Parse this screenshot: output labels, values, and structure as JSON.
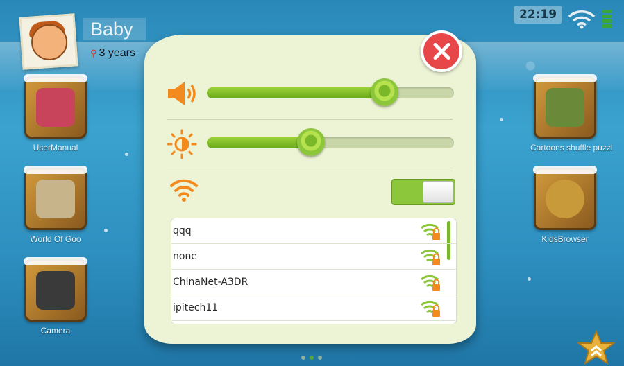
{
  "status_bar": {
    "time": "22:19"
  },
  "profile": {
    "name": "Baby",
    "age": "3 years"
  },
  "apps": {
    "user_manual": "UserManual",
    "world_of_goo": "World Of Goo",
    "camera": "Camera",
    "cartoons": "Cartoons shuffle puzzl",
    "kids_browser": "KidsBrowser"
  },
  "settings": {
    "volume_level": 0.72,
    "brightness_level": 0.42,
    "wifi_enabled": true,
    "networks": [
      {
        "name": "qqq",
        "secured": true
      },
      {
        "name": "none",
        "secured": true
      },
      {
        "name": "ChinaNet-A3DR",
        "secured": true
      },
      {
        "name": "ipitech11",
        "secured": true
      }
    ]
  },
  "colors": {
    "accent_green": "#8cc63a",
    "icon_orange": "#f28a1e",
    "close_red": "#e8474a"
  },
  "icons": [
    "close-icon",
    "volume-icon",
    "brightness-icon",
    "wifi-icon",
    "wifi-lock-icon",
    "star-icon"
  ]
}
